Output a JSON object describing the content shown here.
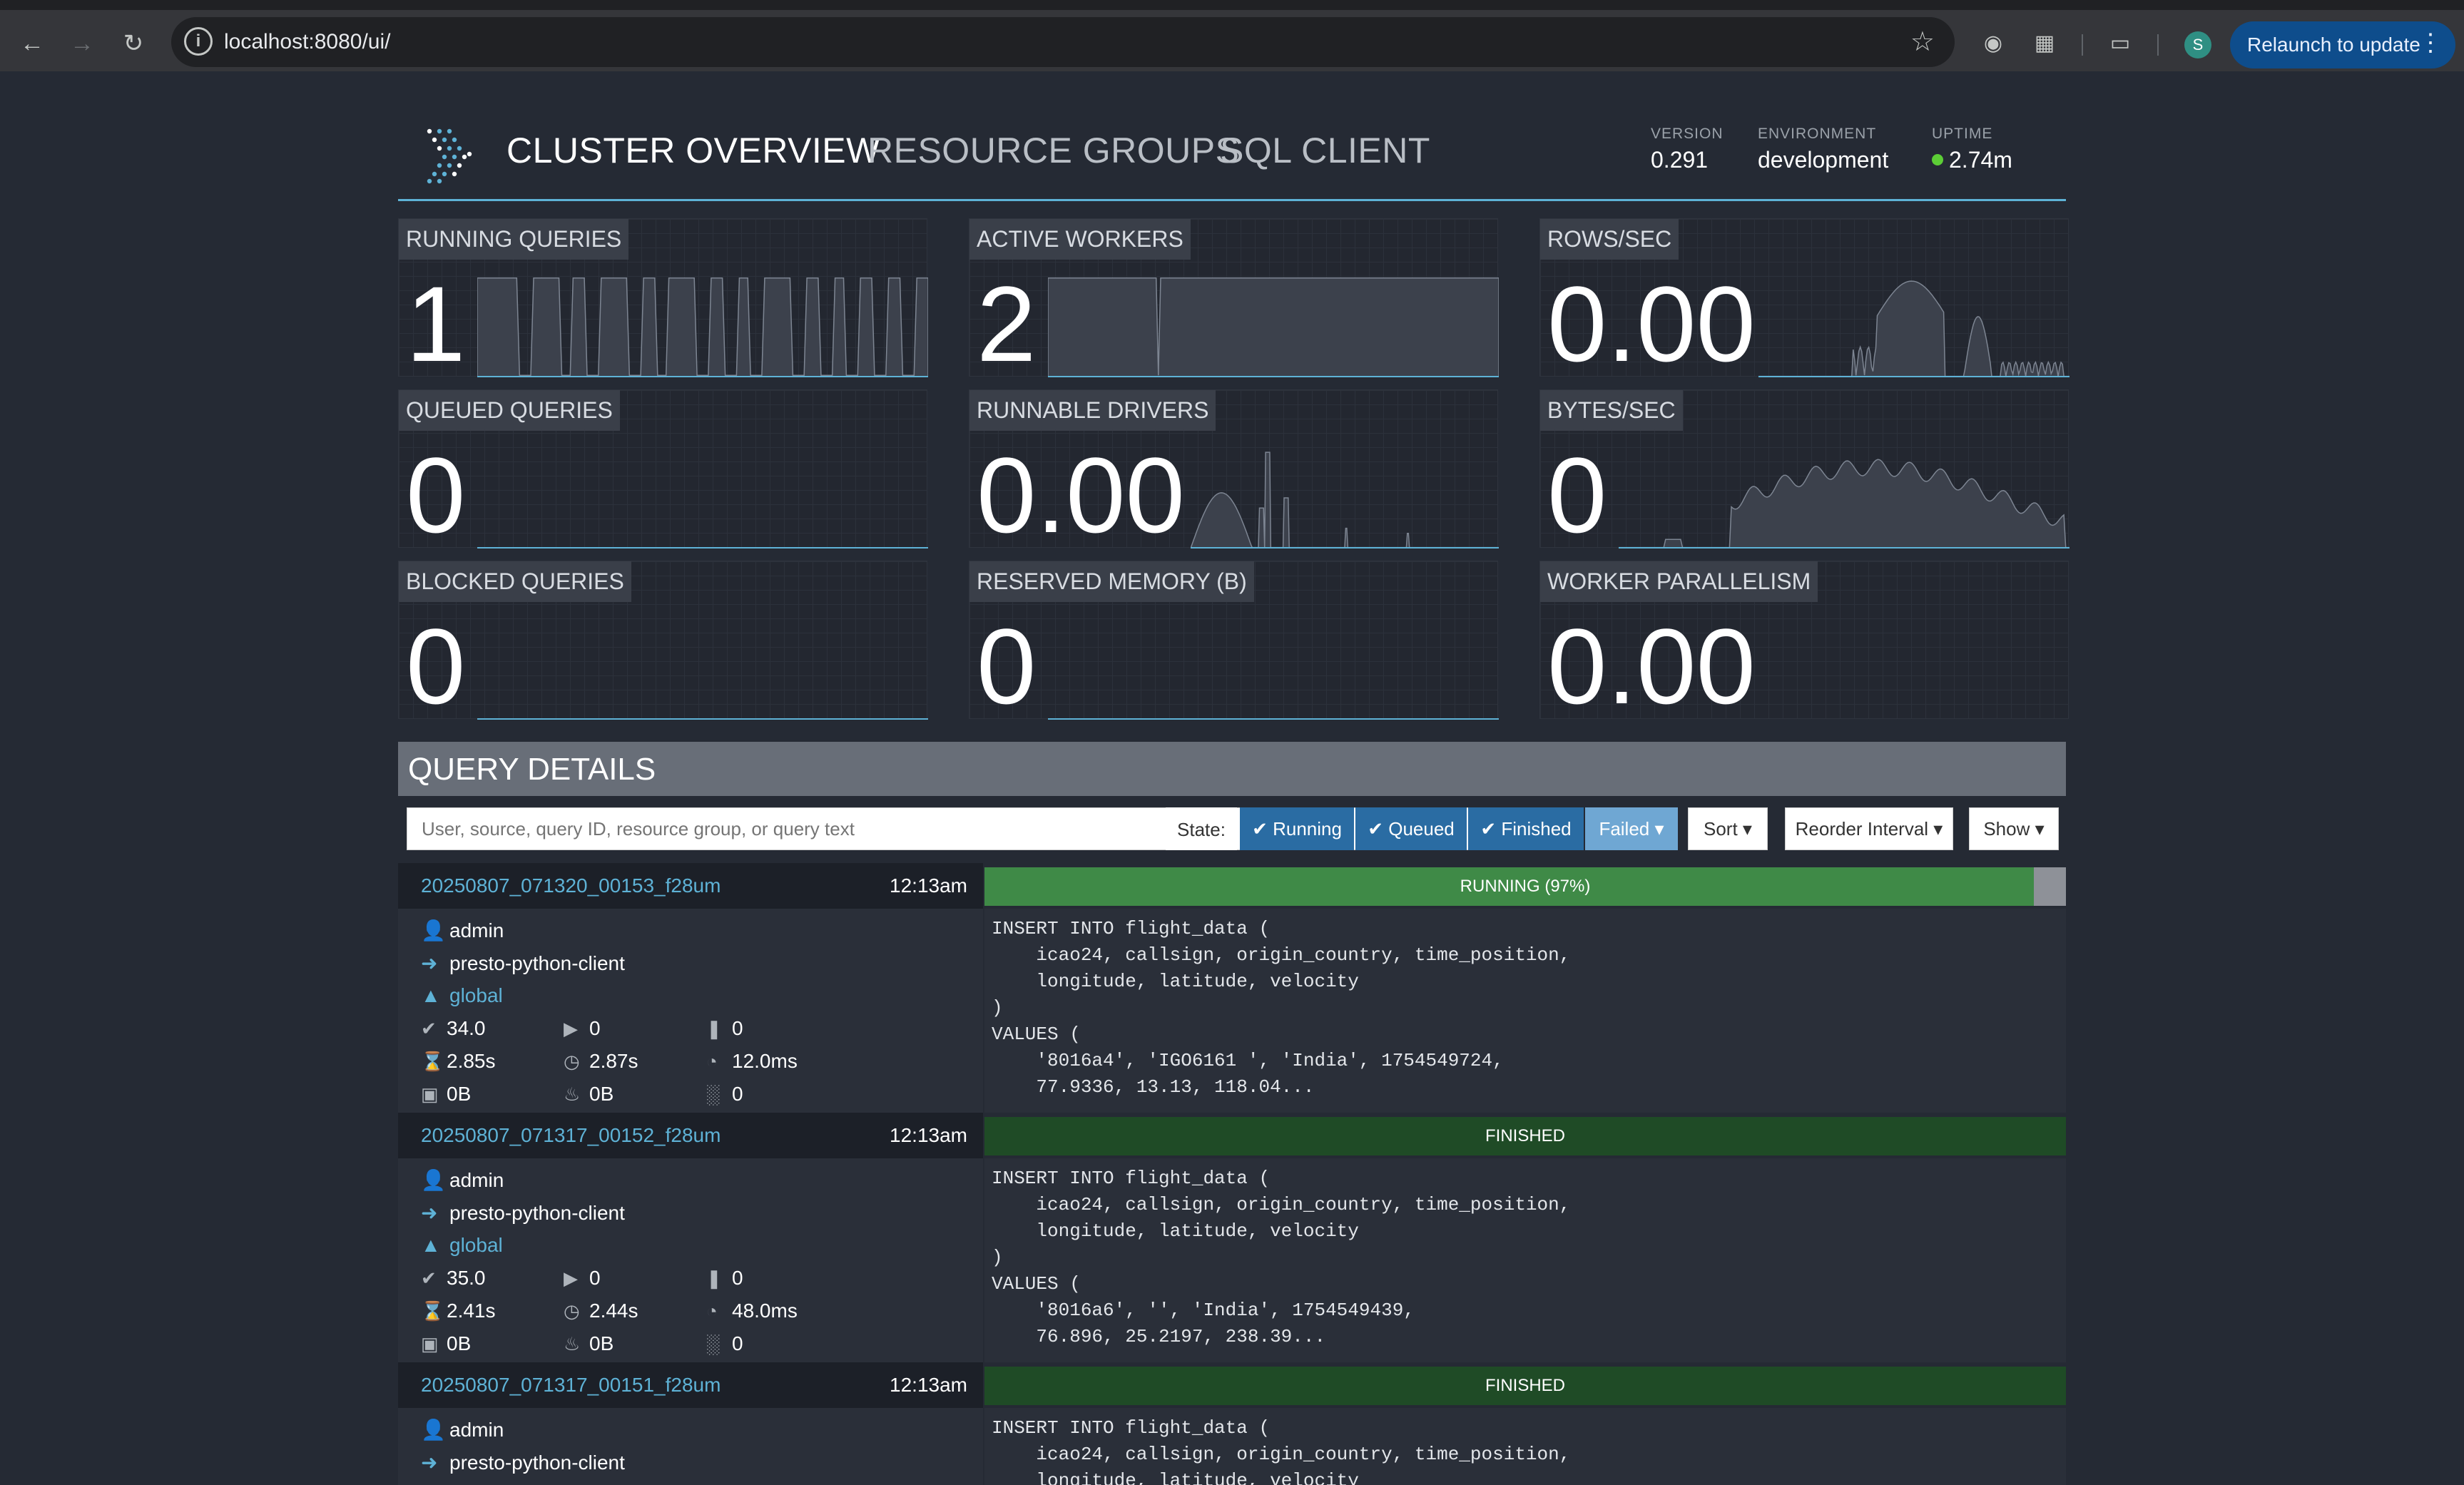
{
  "browser": {
    "url": "localhost:8080/ui/",
    "avatar_initial": "S",
    "relaunch_label": "Relaunch to update"
  },
  "header": {
    "nav": [
      "CLUSTER OVERVIEW",
      "RESOURCE GROUPS",
      "SQL CLIENT"
    ],
    "version_key": "VERSION",
    "version": "0.291",
    "env_key": "ENVIRONMENT",
    "env": "development",
    "uptime_key": "UPTIME",
    "uptime": "2.74m",
    "uptime_color": "#5ccd36"
  },
  "metrics": [
    {
      "label": "RUNNING QUERIES",
      "value": "1"
    },
    {
      "label": "ACTIVE WORKERS",
      "value": "2"
    },
    {
      "label": "ROWS/SEC",
      "value": "0.00"
    },
    {
      "label": "QUEUED QUERIES",
      "value": "0"
    },
    {
      "label": "RUNNABLE DRIVERS",
      "value": "0.00"
    },
    {
      "label": "BYTES/SEC",
      "value": "0"
    },
    {
      "label": "BLOCKED QUERIES",
      "value": "0"
    },
    {
      "label": "RESERVED MEMORY (B)",
      "value": "0"
    },
    {
      "label": "WORKER PARALLELISM",
      "value": "0.00"
    }
  ],
  "query_details": {
    "title": "QUERY DETAILS",
    "search_placeholder": "User, source, query ID, resource group, or query text",
    "state_label": "State:",
    "state_filters": [
      "Running",
      "Queued",
      "Finished",
      "Failed"
    ],
    "sort_label": "Sort",
    "reorder_label": "Reorder Interval",
    "show_label": "Show"
  },
  "queries": [
    {
      "id": "20250807_071320_00153_f28um",
      "time": "12:13am",
      "user": "admin",
      "source": "presto-python-client",
      "resource_group": "global",
      "state": "RUNNING (97%)",
      "progress": 0.97,
      "stats": [
        "34.0",
        "0",
        "0",
        "2.85s",
        "2.87s",
        "12.0ms",
        "0B",
        "0B",
        "0"
      ],
      "sql": "INSERT INTO flight_data (\n    icao24, callsign, origin_country, time_position,\n    longitude, latitude, velocity\n)\nVALUES (\n    '8016a4', 'IGO6161 ', 'India', 1754549724,\n    77.9336, 13.13, 118.04..."
    },
    {
      "id": "20250807_071317_00152_f28um",
      "time": "12:13am",
      "user": "admin",
      "source": "presto-python-client",
      "resource_group": "global",
      "state": "FINISHED",
      "progress": 1,
      "stats": [
        "35.0",
        "0",
        "0",
        "2.41s",
        "2.44s",
        "48.0ms",
        "0B",
        "0B",
        "0"
      ],
      "sql": "INSERT INTO flight_data (\n    icao24, callsign, origin_country, time_position,\n    longitude, latitude, velocity\n)\nVALUES (\n    '8016a6', '', 'India', 1754549439,\n    76.896, 25.2197, 238.39..."
    },
    {
      "id": "20250807_071317_00151_f28um",
      "time": "12:13am",
      "user": "admin",
      "source": "presto-python-client",
      "state": "FINISHED",
      "progress": 1,
      "sql": "INSERT INTO flight_data (\n    icao24, callsign, origin_country, time_position,\n    longitude, latitude, velocity"
    }
  ]
}
